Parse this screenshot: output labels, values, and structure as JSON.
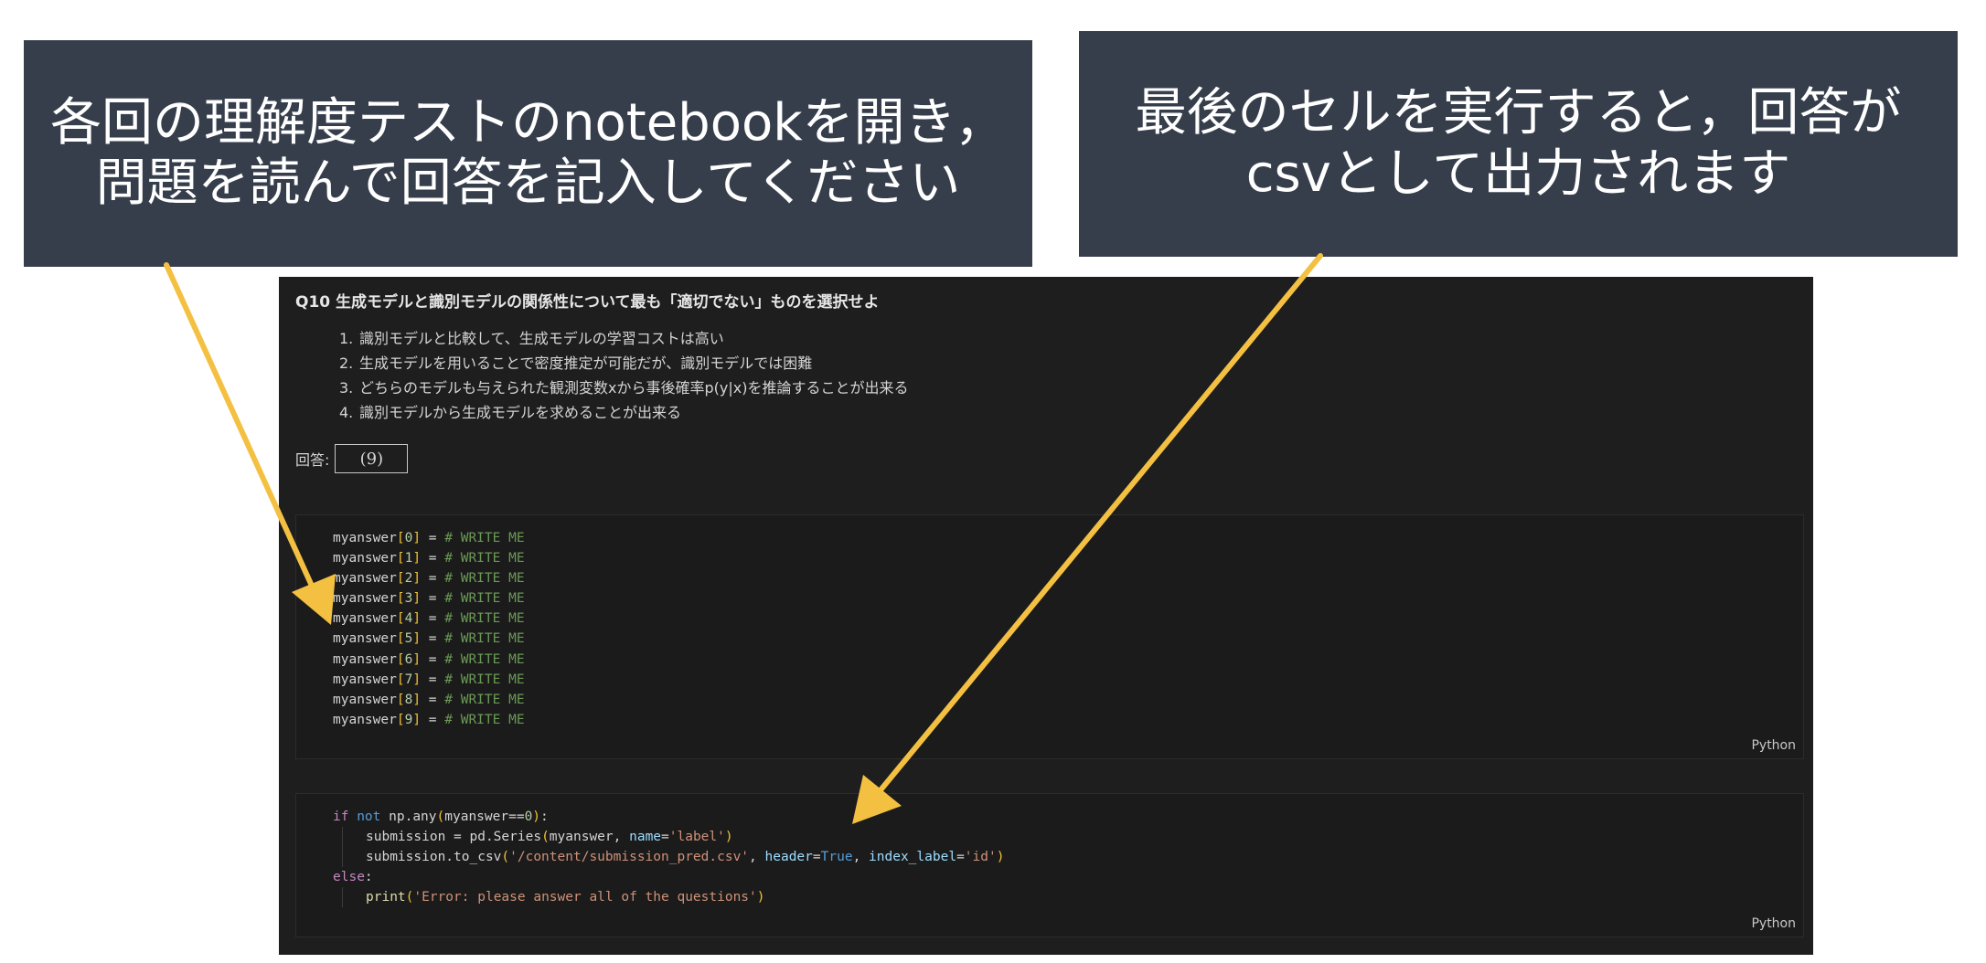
{
  "callouts": {
    "left": {
      "line1": "各回の理解度テストのnotebookを開き，",
      "line2": "問題を読んで回答を記入してください"
    },
    "right": {
      "line1": "最後のセルを実行すると，回答が",
      "line2": "csvとして出力されます"
    }
  },
  "question": {
    "title": "Q10 生成モデルと識別モデルの関係性について最も「適切でない」ものを選択せよ",
    "options": [
      {
        "num": "1.",
        "text": "識別モデルと比較して、生成モデルの学習コストは高い"
      },
      {
        "num": "2.",
        "text": "生成モデルを用いることで密度推定が可能だが、識別モデルでは困難"
      },
      {
        "num": "3.",
        "text": "どちらのモデルも与えられた観測変数xから事後確率p(y|x)を推論することが出来る"
      },
      {
        "num": "4.",
        "text": "識別モデルから生成モデルを求めることが出来る"
      }
    ],
    "answer_label": "回答:",
    "answer_value": "(9)"
  },
  "cells": [
    {
      "language": "Python",
      "lines": [
        {
          "var": "myanswer",
          "open": "[",
          "idx": "0",
          "close": "]",
          "op": " = ",
          "comment": "# WRITE ME"
        },
        {
          "var": "myanswer",
          "open": "[",
          "idx": "1",
          "close": "]",
          "op": " = ",
          "comment": "# WRITE ME"
        },
        {
          "var": "myanswer",
          "open": "[",
          "idx": "2",
          "close": "]",
          "op": " = ",
          "comment": "# WRITE ME"
        },
        {
          "var": "myanswer",
          "open": "[",
          "idx": "3",
          "close": "]",
          "op": " = ",
          "comment": "# WRITE ME"
        },
        {
          "var": "myanswer",
          "open": "[",
          "idx": "4",
          "close": "]",
          "op": " = ",
          "comment": "# WRITE ME"
        },
        {
          "var": "myanswer",
          "open": "[",
          "idx": "5",
          "close": "]",
          "op": " = ",
          "comment": "# WRITE ME"
        },
        {
          "var": "myanswer",
          "open": "[",
          "idx": "6",
          "close": "]",
          "op": " = ",
          "comment": "# WRITE ME"
        },
        {
          "var": "myanswer",
          "open": "[",
          "idx": "7",
          "close": "]",
          "op": " = ",
          "comment": "# WRITE ME"
        },
        {
          "var": "myanswer",
          "open": "[",
          "idx": "8",
          "close": "]",
          "op": " = ",
          "comment": "# WRITE ME"
        },
        {
          "var": "myanswer",
          "open": "[",
          "idx": "9",
          "close": "]",
          "op": " = ",
          "comment": "# WRITE ME"
        }
      ]
    },
    {
      "language": "Python",
      "line1": {
        "if": "if",
        "not": "not",
        "call": " np.any",
        "open": "(",
        "arg": "myanswer==",
        "num": "0",
        "close": ")",
        "colon": ":"
      },
      "line2": {
        "lhs": "submission = pd.Series",
        "open": "(",
        "arg": "myanswer, ",
        "param": "name",
        "eq": "=",
        "str": "'label'",
        "close": ")"
      },
      "line3": {
        "lhs": "submission.to_csv",
        "open": "(",
        "str1": "'/content/submission_pred.csv'",
        "sep1": ", ",
        "param1": "header",
        "eq1": "=",
        "true": "True",
        "sep2": ", ",
        "param2": "index_label",
        "eq2": "=",
        "str2": "'id'",
        "close": ")"
      },
      "line4": {
        "else": "else",
        "colon": ":"
      },
      "line5": {
        "fn": "print",
        "open": "(",
        "str": "'Error: please answer all of the questions'",
        "close": ")"
      }
    }
  ],
  "colors": {
    "callout_bg": "#363e4c",
    "notebook_bg": "#1e1e1e",
    "arrow": "#f4c042",
    "comment": "#6a9955",
    "keyword": "#c586c0",
    "string": "#ce9178",
    "bracket": "#f1c232"
  }
}
